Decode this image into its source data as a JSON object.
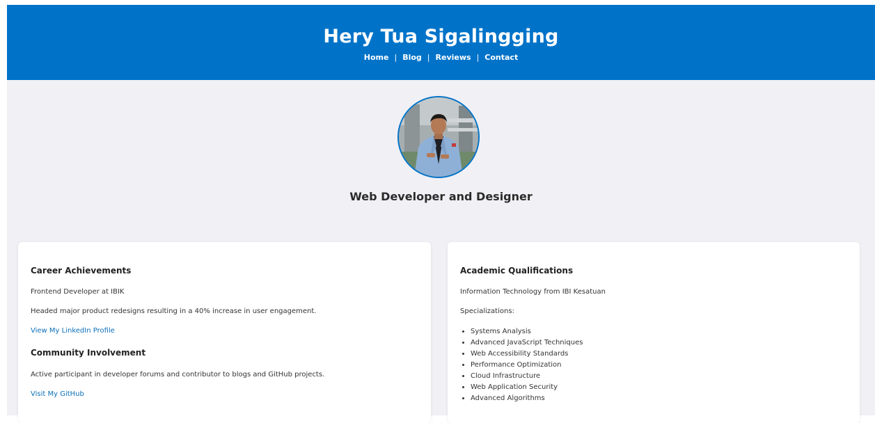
{
  "header": {
    "title": "Hery Tua Sigalingging",
    "nav": [
      {
        "label": "Home"
      },
      {
        "label": "Blog"
      },
      {
        "label": "Reviews"
      },
      {
        "label": "Contact"
      }
    ],
    "separator": "|"
  },
  "profile": {
    "tagline": "Web Developer and Designer"
  },
  "career": {
    "heading": "Career Achievements",
    "role": "Frontend Developer at IBIK",
    "achievement": "Headed major product redesigns resulting in a 40% increase in user engagement.",
    "linkedin_link": "View My LinkedIn Profile"
  },
  "community": {
    "heading": "Community Involvement",
    "text": "Active participant in developer forums and contributor to blogs and GitHub projects.",
    "github_link": "Visit My GitHub"
  },
  "academic": {
    "heading": "Academic Qualifications",
    "degree": "Information Technology from IBI Kesatuan",
    "specializations_label": "Specializations:",
    "specializations": [
      "Systems Analysis",
      "Advanced JavaScript Techniques",
      "Web Accessibility Standards",
      "Performance Optimization",
      "Cloud Infrastructure",
      "Web Application Security",
      "Advanced Algorithms"
    ]
  },
  "colors": {
    "brand_blue": "#0073c9",
    "link_blue": "#0b6fb8",
    "page_background": "#f0f0f5"
  },
  "icons": {
    "avatar": "profile-photo"
  }
}
